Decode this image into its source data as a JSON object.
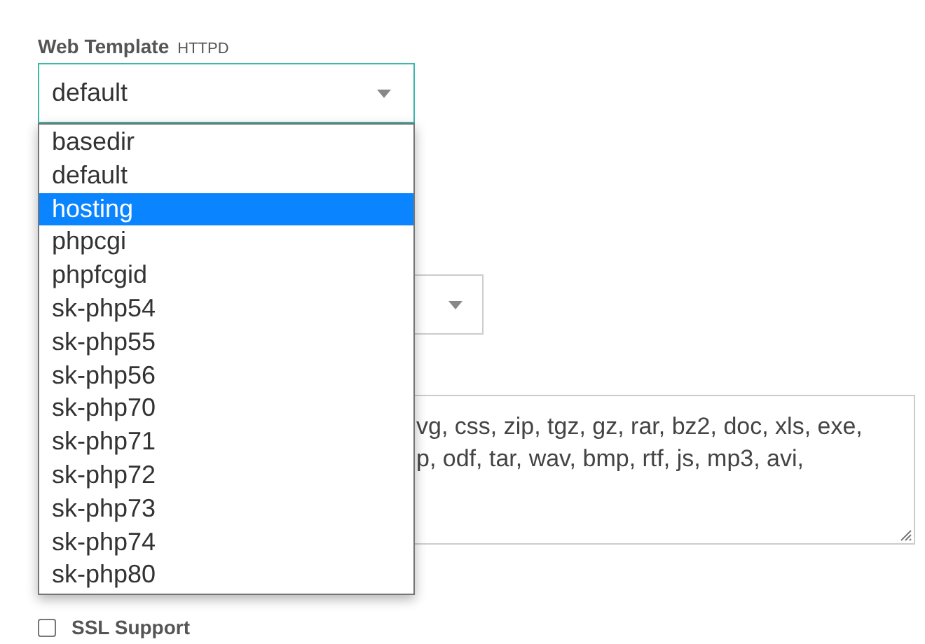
{
  "web_template": {
    "label": "Web Template",
    "tag": "HTTPD",
    "value": "default",
    "expanded": true,
    "options": [
      {
        "label": "basedir",
        "highlighted": false
      },
      {
        "label": "default",
        "highlighted": false
      },
      {
        "label": "hosting",
        "highlighted": true
      },
      {
        "label": "phpcgi",
        "highlighted": false
      },
      {
        "label": "phpfcgid",
        "highlighted": false
      },
      {
        "label": "sk-php54",
        "highlighted": false
      },
      {
        "label": "sk-php55",
        "highlighted": false
      },
      {
        "label": "sk-php56",
        "highlighted": false
      },
      {
        "label": "sk-php70",
        "highlighted": false
      },
      {
        "label": "sk-php71",
        "highlighted": false
      },
      {
        "label": "sk-php72",
        "highlighted": false
      },
      {
        "label": "sk-php73",
        "highlighted": false
      },
      {
        "label": "sk-php74",
        "highlighted": false
      },
      {
        "label": "sk-php80",
        "highlighted": false
      }
    ]
  },
  "extensions_field": {
    "lines": [
      "vg, css, zip, tgz, gz, rar, bz2, doc, xls, exe,",
      "p, odf, tar, wav, bmp, rtf, js, mp3, avi,"
    ]
  },
  "ssl_support": {
    "label": "SSL Support",
    "checked": false
  }
}
